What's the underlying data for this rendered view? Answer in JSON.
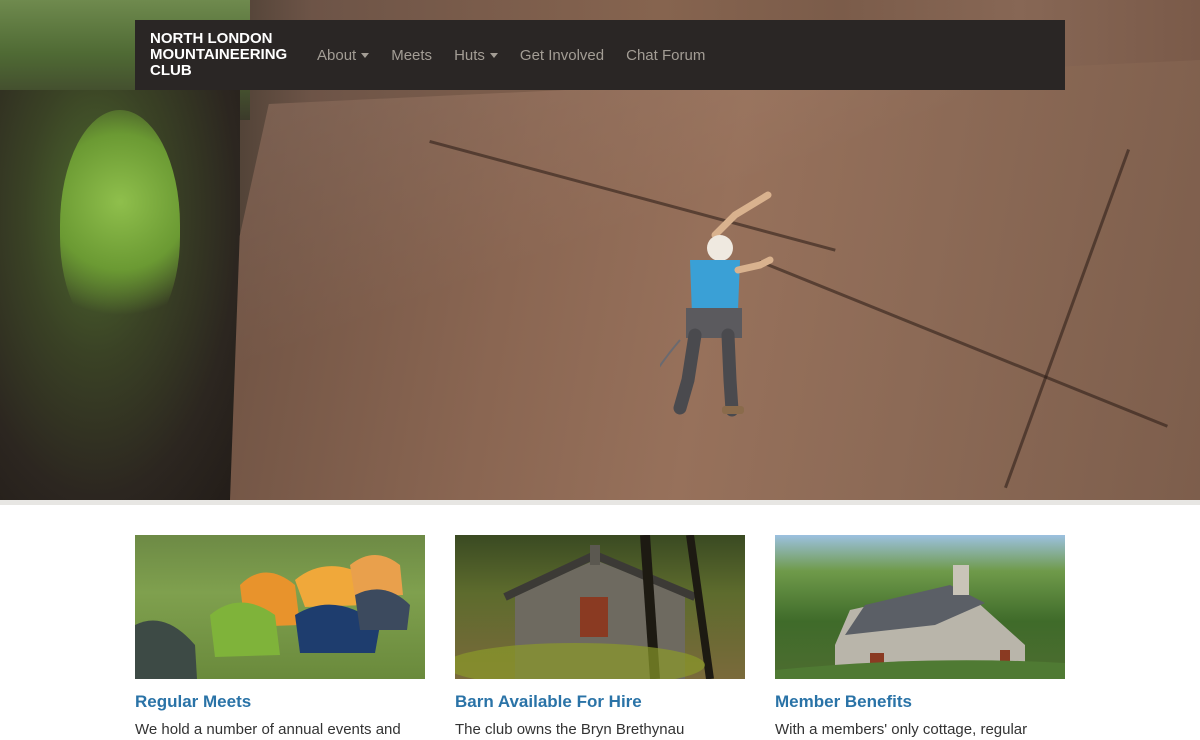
{
  "site": {
    "brand": "NORTH LONDON MOUNTAINEERING CLUB"
  },
  "nav": {
    "items": [
      {
        "label": "About",
        "dropdown": true
      },
      {
        "label": "Meets",
        "dropdown": false
      },
      {
        "label": "Huts",
        "dropdown": true
      },
      {
        "label": "Get Involved",
        "dropdown": false
      },
      {
        "label": "Chat Forum",
        "dropdown": false
      }
    ]
  },
  "cards": [
    {
      "title": "Regular Meets",
      "text": "We hold a number of annual events and"
    },
    {
      "title": "Barn Available For Hire",
      "text": "The club owns the Bryn Brethynau"
    },
    {
      "title": "Member Benefits",
      "text": "With a members' only cottage, regular"
    }
  ],
  "colors": {
    "navbar": "#2a2625",
    "nav_text": "#a39d95",
    "heading": "#2a73a7"
  }
}
